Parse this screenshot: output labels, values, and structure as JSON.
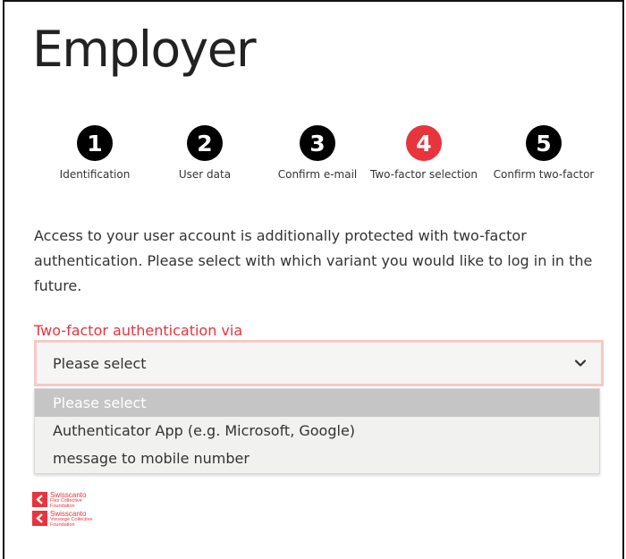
{
  "page": {
    "title": "Employer"
  },
  "steps": [
    {
      "number": "1",
      "label": "Identification",
      "state": "done"
    },
    {
      "number": "2",
      "label": "User data",
      "state": "done"
    },
    {
      "number": "3",
      "label": "Confirm e-mail",
      "state": "done"
    },
    {
      "number": "4",
      "label": "Two-factor selection",
      "state": "active"
    },
    {
      "number": "5",
      "label": "Confirm two-factor",
      "state": "todo"
    }
  ],
  "intro_text": "Access to your user account is additionally protected with two-factor authentication. Please select with which variant you would like to log in in the future.",
  "field": {
    "label": "Two-factor authentication via",
    "selected_value": "Please select",
    "options": [
      "Please select",
      "Authenticator App (e.g. Microsoft, Google)",
      "message to mobile number"
    ],
    "highlighted_option": "Please select"
  },
  "logos": [
    {
      "name": "Swisscanto",
      "sub_line1": "Flex Collective",
      "sub_line2": "Foundation"
    },
    {
      "name": "Swisscanto",
      "sub_line1": "Vorsorge Collective",
      "sub_line2": "Foundation"
    }
  ],
  "colors": {
    "accent": "#e7343d",
    "step_inactive": "#000000",
    "select_border": "#f5c9c8",
    "select_bg": "#f5f5f4",
    "option_highlight": "#c5c5c5"
  },
  "icons": {
    "select_chevron": "chevron-down-icon",
    "logo_mark": "swisscanto-logo-icon"
  }
}
